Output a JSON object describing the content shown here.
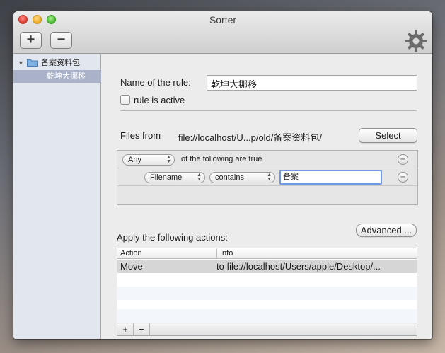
{
  "window": {
    "title": "Sorter"
  },
  "toolbar": {
    "add_label": "+",
    "remove_label": "−"
  },
  "sidebar": {
    "group": {
      "label": "备案资料包"
    },
    "items": [
      {
        "label": "乾坤大挪移"
      }
    ]
  },
  "rule": {
    "name_label": "Name of the rule:",
    "name_value": "乾坤大挪移",
    "active_label": "rule is active",
    "active_checked": false,
    "files_from_label": "Files from",
    "files_from_path": "file://localhost/U...p/old/备案资料包/",
    "select_label": "Select"
  },
  "conditions": {
    "match_option": "Any",
    "match_text": "of the following are true",
    "rows": [
      {
        "field": "Filename",
        "operator": "contains",
        "value": "备案"
      }
    ]
  },
  "actions": {
    "advanced_label": "Advanced ...",
    "heading": "Apply the following actions:",
    "columns": [
      "Action",
      "Info"
    ],
    "rows": [
      {
        "action": "Move",
        "info": "to file://localhost/Users/apple/Desktop/..."
      }
    ],
    "add_label": "+",
    "remove_label": "−"
  }
}
